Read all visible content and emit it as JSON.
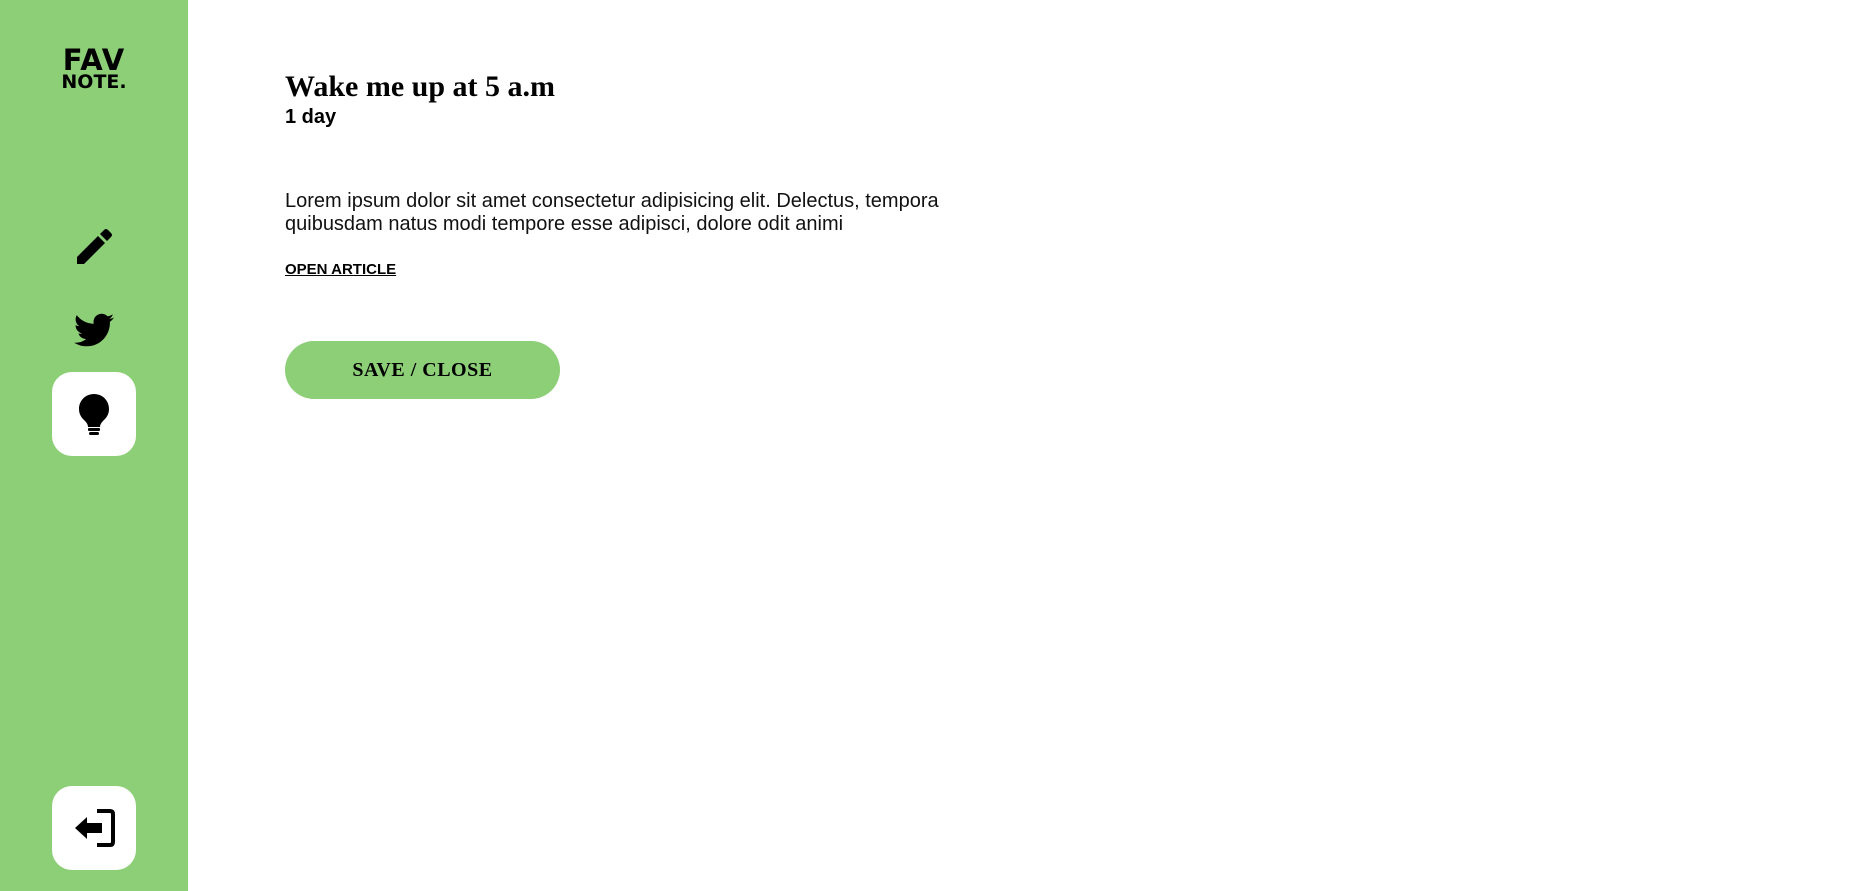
{
  "brand": {
    "logo_line1": "FAV",
    "logo_line2": "NOTE.",
    "accent_color": "#8ccf77"
  },
  "sidebar": {
    "items": [
      {
        "icon": "pencil-icon",
        "active": false
      },
      {
        "icon": "twitter-bird-icon",
        "active": false
      },
      {
        "icon": "lightbulb-icon",
        "active": true
      }
    ],
    "logout_icon": "logout-icon"
  },
  "note": {
    "title": "Wake me up at 5 a.m",
    "date": "1 day",
    "content": "Lorem ipsum dolor sit amet consectetur adipisicing elit. Delectus, tempora quibusdam natus modi tempore esse adipisci, dolore odit animi",
    "link_label": "OPEN ARTICLE",
    "button_label": "SAVE / CLOSE"
  }
}
